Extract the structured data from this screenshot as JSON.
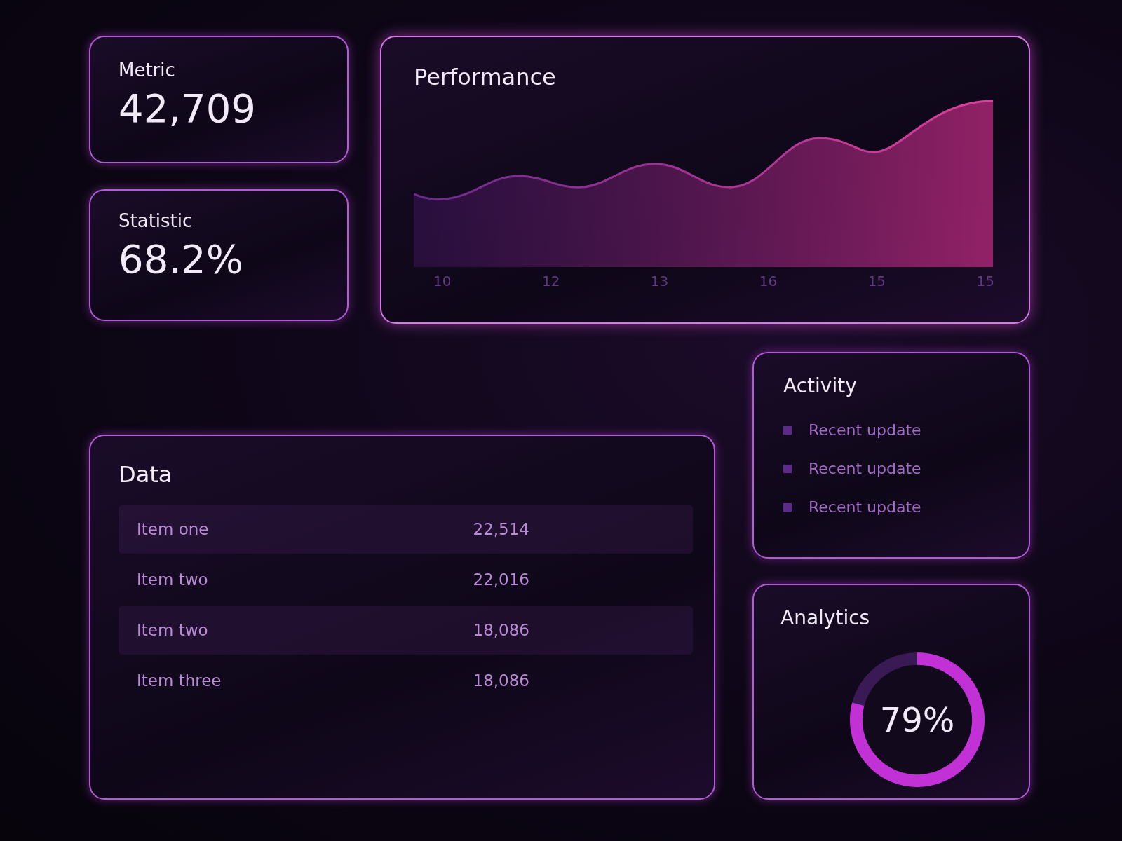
{
  "stats": [
    {
      "label": "Metric",
      "value": "42,709"
    },
    {
      "label": "Statistic",
      "value": "68.2%"
    }
  ],
  "performance": {
    "title": "Performance",
    "x_labels": [
      "10",
      "12",
      "13",
      "16",
      "15",
      "15"
    ]
  },
  "data": {
    "title": "Data",
    "rows": [
      {
        "name": "Item one",
        "value": "22,514"
      },
      {
        "name": "Item two",
        "value": "22,016"
      },
      {
        "name": "Item two",
        "value": "18,086"
      },
      {
        "name": "Item three",
        "value": "18,086"
      }
    ]
  },
  "activity": {
    "title": "Activity",
    "items": [
      "Recent update",
      "Recent update",
      "Recent update"
    ]
  },
  "analytics": {
    "title": "Analytics",
    "reading": "79%"
  }
}
